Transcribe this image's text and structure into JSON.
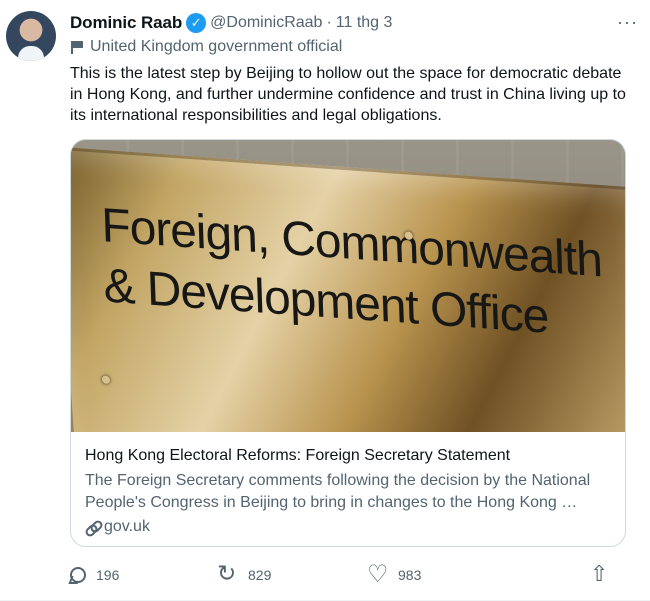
{
  "author": {
    "name": "Dominic Raab",
    "handle": "@DominicRaab",
    "separator": "·",
    "date": "11 thg 3",
    "affiliation": "United Kingdom government official"
  },
  "tweet": {
    "text": "This is the latest step by Beijing to hollow out the space for democratic debate in Hong Kong, and further undermine confidence and trust in China living up to its international responsibilities and legal obligations."
  },
  "card": {
    "image_text_lines": [
      "Foreign, Commonwealth",
      "& Development Office"
    ],
    "title": "Hong Kong Electoral Reforms: Foreign Secretary Statement",
    "description": "The Foreign Secretary comments following the decision by the National People's Congress in Beijing to bring in changes to the Hong Kong …",
    "domain": "gov.uk"
  },
  "actions": {
    "replies": "196",
    "retweets": "829",
    "likes": "983"
  },
  "icons": {
    "verified": "verified-badge-icon",
    "more": "more-options-icon",
    "affiliation": "flag-icon",
    "link": "link-icon",
    "reply": "reply-icon",
    "retweet": "retweet-icon",
    "like": "heart-icon",
    "share": "share-icon"
  },
  "colors": {
    "verified": "#1d9bf0",
    "secondary_text": "#536471",
    "border": "#cfd9de"
  }
}
